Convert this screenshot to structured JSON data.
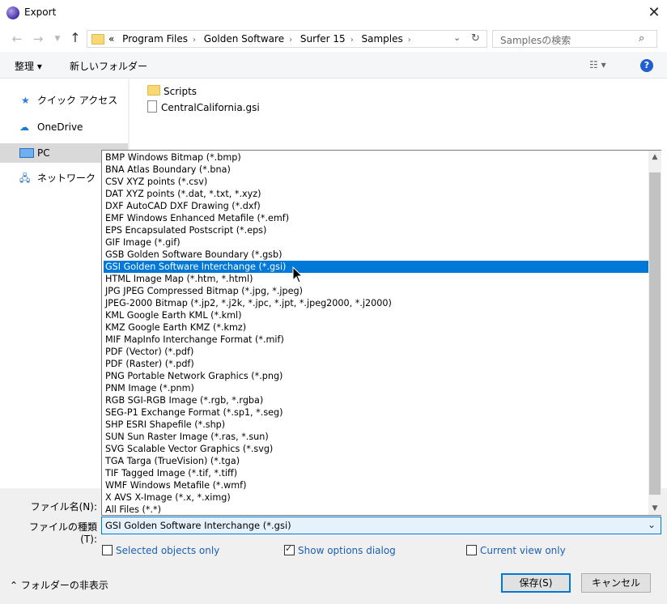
{
  "window": {
    "title": "Export",
    "close_glyph": "✕"
  },
  "nav": {
    "breadcrumb": [
      "«",
      "Program Files",
      "Golden Software",
      "Surfer 15",
      "Samples"
    ],
    "search_placeholder": "Samplesの検索"
  },
  "toolbar": {
    "organize": "整理 ▾",
    "new_folder": "新しいフォルダー"
  },
  "sidebar": {
    "items": [
      {
        "label": "クイック アクセス",
        "icon": "star-icon"
      },
      {
        "label": "OneDrive",
        "icon": "cloud-icon"
      },
      {
        "label": "PC",
        "icon": "pc-icon"
      },
      {
        "label": "ネットワーク",
        "icon": "network-icon"
      }
    ]
  },
  "files": [
    {
      "name": "Scripts",
      "icon": "folder-icon"
    },
    {
      "name": "CentralCalifornia.gsi",
      "icon": "file-icon"
    }
  ],
  "filetype_options": [
    "BMP Windows Bitmap (*.bmp)",
    "BNA Atlas Boundary (*.bna)",
    "CSV XYZ points (*.csv)",
    "DAT XYZ points (*.dat, *.txt, *.xyz)",
    "DXF AutoCAD DXF Drawing (*.dxf)",
    "EMF Windows Enhanced Metafile (*.emf)",
    "EPS Encapsulated Postscript (*.eps)",
    "GIF Image (*.gif)",
    "GSB Golden Software Boundary (*.gsb)",
    "GSI Golden Software Interchange (*.gsi)",
    "HTML Image Map (*.htm, *.html)",
    "JPG JPEG Compressed Bitmap (*.jpg, *.jpeg)",
    "JPEG-2000 Bitmap (*.jp2, *.j2k, *.jpc, *.jpt, *.jpeg2000, *.j2000)",
    "KML Google Earth KML (*.kml)",
    "KMZ Google Earth KMZ (*.kmz)",
    "MIF MapInfo Interchange Format (*.mif)",
    "PDF (Vector) (*.pdf)",
    "PDF (Raster) (*.pdf)",
    "PNG Portable Network Graphics (*.png)",
    "PNM Image (*.pnm)",
    "RGB SGI-RGB Image (*.rgb, *.rgba)",
    "SEG-P1 Exchange Format (*.sp1, *.seg)",
    "SHP ESRI Shapefile (*.shp)",
    "SUN Sun Raster Image (*.ras, *.sun)",
    "SVG Scalable Vector Graphics (*.svg)",
    "TGA Targa (TrueVision) (*.tga)",
    "TIF Tagged Image (*.tif, *.tiff)",
    "WMF Windows Metafile (*.wmf)",
    "X   AVS X-Image (*.x, *.ximg)",
    "All Files (*.*)"
  ],
  "selected_index": 9,
  "form": {
    "filename_label": "ファイル名(N):",
    "filetype_label": "ファイルの種類(T):",
    "filetype_value": "GSI Golden Software Interchange (*.gsi)"
  },
  "options": {
    "selected_only": {
      "label": "Selected objects only",
      "checked": false
    },
    "show_options": {
      "label": "Show options dialog",
      "checked": true
    },
    "current_view": {
      "label": "Current view only",
      "checked": false
    }
  },
  "footer": {
    "hide_folders": "フォルダーの非表示",
    "save": "保存(S)",
    "cancel": "キャンセル"
  },
  "colors": {
    "selection": "#0078d7",
    "accent": "#1a5fb4"
  }
}
